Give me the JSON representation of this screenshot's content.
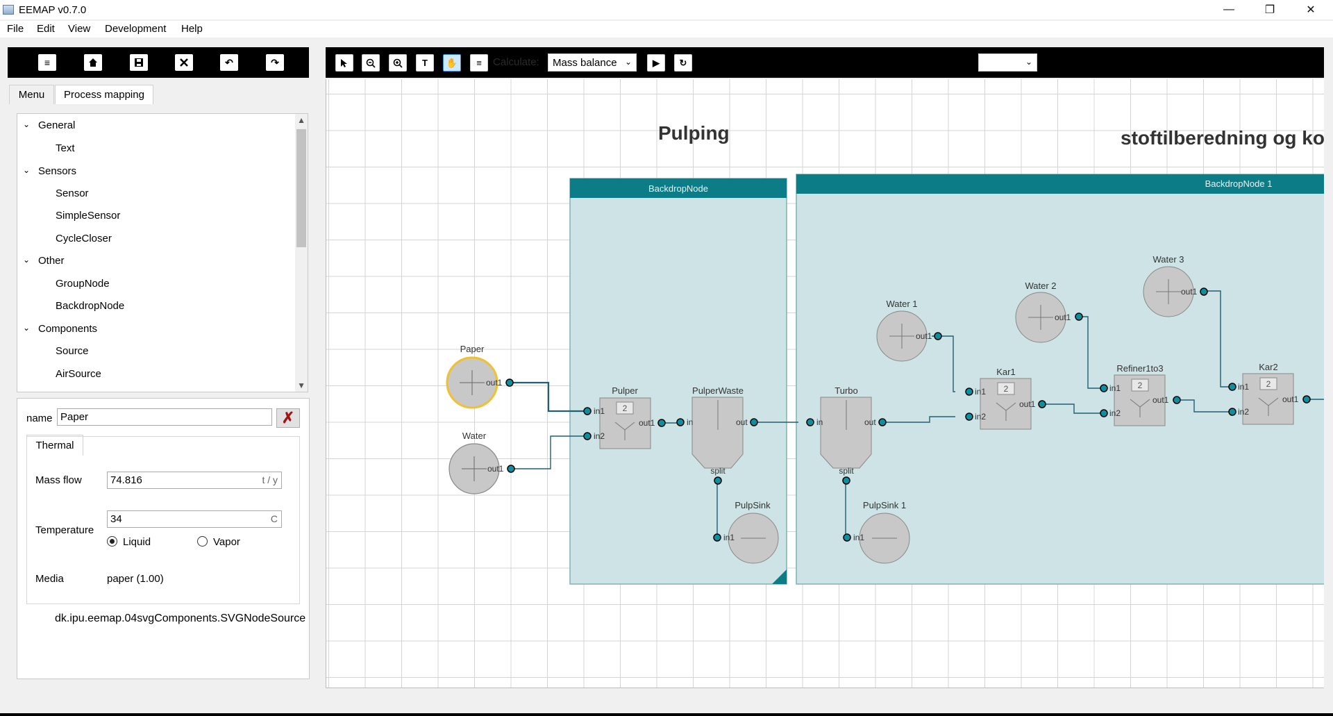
{
  "window": {
    "title": "EEMAP v0.7.0",
    "minimize": "—",
    "maximize": "❐",
    "close": "✕"
  },
  "menubar": [
    "File",
    "Edit",
    "View",
    "Development",
    "Help"
  ],
  "left_toolbar": {
    "icons": [
      "menu-icon",
      "home-icon",
      "save-icon",
      "tools-icon",
      "undo-icon",
      "redo-icon"
    ]
  },
  "tabs": {
    "menu": "Menu",
    "process_mapping": "Process mapping"
  },
  "palette": {
    "groups": [
      {
        "label": "General",
        "items": [
          "Text"
        ]
      },
      {
        "label": "Sensors",
        "items": [
          "Sensor",
          "SimpleSensor",
          "CycleCloser"
        ]
      },
      {
        "label": "Other",
        "items": [
          "GroupNode",
          "BackdropNode"
        ]
      },
      {
        "label": "Components",
        "items": [
          "Source",
          "AirSource"
        ]
      }
    ]
  },
  "properties": {
    "name_label": "name",
    "name_value": "Paper",
    "thermal_tab": "Thermal",
    "mass_flow_label": "Mass flow",
    "mass_flow_value": "74.816",
    "mass_flow_unit": "t / y",
    "temperature_label": "Temperature",
    "temperature_value": "34",
    "temperature_unit": "C",
    "liquid_label": "Liquid",
    "vapor_label": "Vapor",
    "phase_selected": "Liquid",
    "media_label": "Media",
    "media_value": "paper (1.00)",
    "class_name": "dk.ipu.eemap.04svgComponents.SVGNodeSource"
  },
  "right_toolbar": {
    "calculate_label": "Calculate:",
    "calculate_option": "Mass balance",
    "extra_select": ""
  },
  "colors": {
    "backdrop_header": "#0c7d86",
    "backdrop_fill": "#cde3e5",
    "port": "#0d8fa0",
    "link": "#1f5f73",
    "selected": "#f0c030"
  },
  "canvas": {
    "section_titles": [
      "Pulping",
      "stoftilberedning og ko"
    ],
    "backdrops": [
      "BackdropNode",
      "BackdropNode 1"
    ],
    "nodes": {
      "paper": "Paper",
      "water": "Water",
      "pulper": "Pulper",
      "pulper_waste": "PulperWaste",
      "pulp_sink": "PulpSink",
      "turbo": "Turbo",
      "pulp_sink_1": "PulpSink 1",
      "water_1": "Water 1",
      "water_2": "Water 2",
      "water_3": "Water 3",
      "kar1": "Kar1",
      "refiner": "Refiner1to3",
      "kar2": "Kar2"
    },
    "ports": {
      "out1": "out1",
      "in1": "in1",
      "in2": "in2",
      "in": "in",
      "out": "out",
      "split": "split"
    },
    "mixer_count": "2"
  }
}
